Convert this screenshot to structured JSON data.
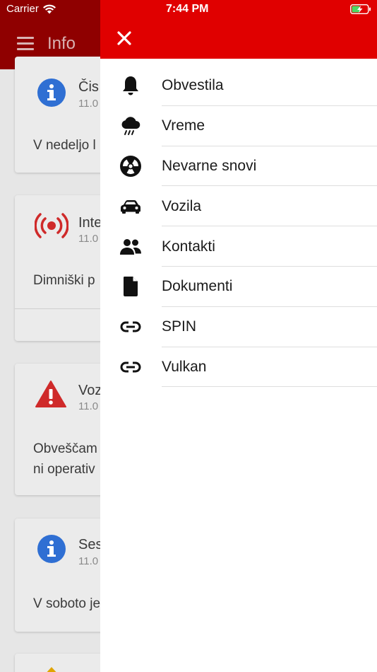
{
  "status": {
    "carrier": "Carrier",
    "time": "7:44 PM"
  },
  "app_bar": {
    "title": "Info"
  },
  "cards": [
    {
      "title": "Čis",
      "date": "11.0",
      "body": [
        "V nedeljo l"
      ],
      "icon": "info-icon"
    },
    {
      "title": "Inte",
      "date": "11.0",
      "body": [
        "Dimniški p"
      ],
      "icon": "alarm-broadcast-icon"
    },
    {
      "title": "Voz",
      "date": "11.0",
      "body": [
        "Obveščam",
        "ni operativ"
      ],
      "icon": "warning-icon"
    },
    {
      "title": "Ses",
      "date": "11.0",
      "body": [
        "V soboto je"
      ],
      "icon": "info-icon"
    }
  ],
  "drawer": {
    "items": [
      {
        "label": "Obvestila",
        "icon": "bell-icon"
      },
      {
        "label": "Vreme",
        "icon": "weather-rain-icon"
      },
      {
        "label": "Nevarne snovi",
        "icon": "radiation-icon"
      },
      {
        "label": "Vozila",
        "icon": "car-icon"
      },
      {
        "label": "Kontakti",
        "icon": "people-icon"
      },
      {
        "label": "Dokumenti",
        "icon": "document-icon"
      },
      {
        "label": "SPIN",
        "icon": "link-icon"
      },
      {
        "label": "Vulkan",
        "icon": "link-icon"
      }
    ]
  },
  "colors": {
    "drawer_header": "#e00000",
    "app_bar_dimmed": "#8f0000",
    "info_blue": "#2f6fd3",
    "alert_red": "#cf2a2a"
  }
}
